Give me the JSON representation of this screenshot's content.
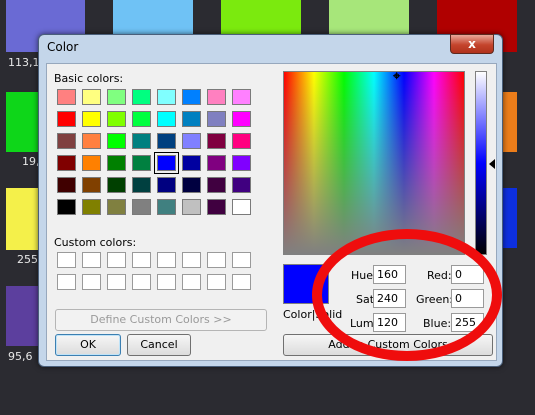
{
  "background": {
    "tiles": [
      {
        "color": "#6a6ad4"
      },
      {
        "color": "#6fc2f5"
      },
      {
        "color": "#7bea0e"
      },
      {
        "color": "#a7e67a"
      },
      {
        "color": "#b00000"
      },
      {
        "color": "#0ed619"
      },
      {
        "color": "#ec7d1a"
      },
      {
        "color": "#f4f04a"
      },
      {
        "color": "#0d2fe0"
      },
      {
        "color": "#5c3f9e"
      },
      {
        "color": "#3a3a3a"
      }
    ],
    "labels": [
      "113,1",
      "19,",
      "255,",
      "95,6"
    ]
  },
  "dialog": {
    "title": "Color",
    "close_label": "x",
    "basic_colors_label": "Basic colors:",
    "basic_colors": [
      "#ff8080",
      "#ffff80",
      "#80ff80",
      "#00ff80",
      "#80ffff",
      "#0080ff",
      "#ff80c0",
      "#ff80ff",
      "#ff0000",
      "#ffff00",
      "#80ff00",
      "#00ff40",
      "#00ffff",
      "#0080c0",
      "#8080c0",
      "#ff00ff",
      "#804040",
      "#ff8040",
      "#00ff00",
      "#008080",
      "#004080",
      "#8080ff",
      "#800040",
      "#ff0080",
      "#800000",
      "#ff8000",
      "#008000",
      "#008040",
      "#0000ff",
      "#0000a0",
      "#800080",
      "#8000ff",
      "#400000",
      "#804000",
      "#004000",
      "#004040",
      "#000080",
      "#000040",
      "#400040",
      "#400080",
      "#000000",
      "#808000",
      "#808040",
      "#808080",
      "#408080",
      "#c0c0c0",
      "#400040",
      "#ffffff"
    ],
    "selected_basic_index": 28,
    "custom_colors_label": "Custom colors:",
    "define_button": "Define Custom Colors >>",
    "ok_button": "OK",
    "cancel_button": "Cancel",
    "color_solid_label": "Color|Solid",
    "hue_label": "Hue:",
    "hue_value": "160",
    "sat_label": "Sat:",
    "sat_value": "240",
    "lum_label": "Lum:",
    "lum_value": "120",
    "red_label": "Red:",
    "red_value": "0",
    "green_label": "Green:",
    "green_value": "0",
    "blue_label": "Blue:",
    "blue_value": "255",
    "add_button": "Add to Custom Colors"
  }
}
